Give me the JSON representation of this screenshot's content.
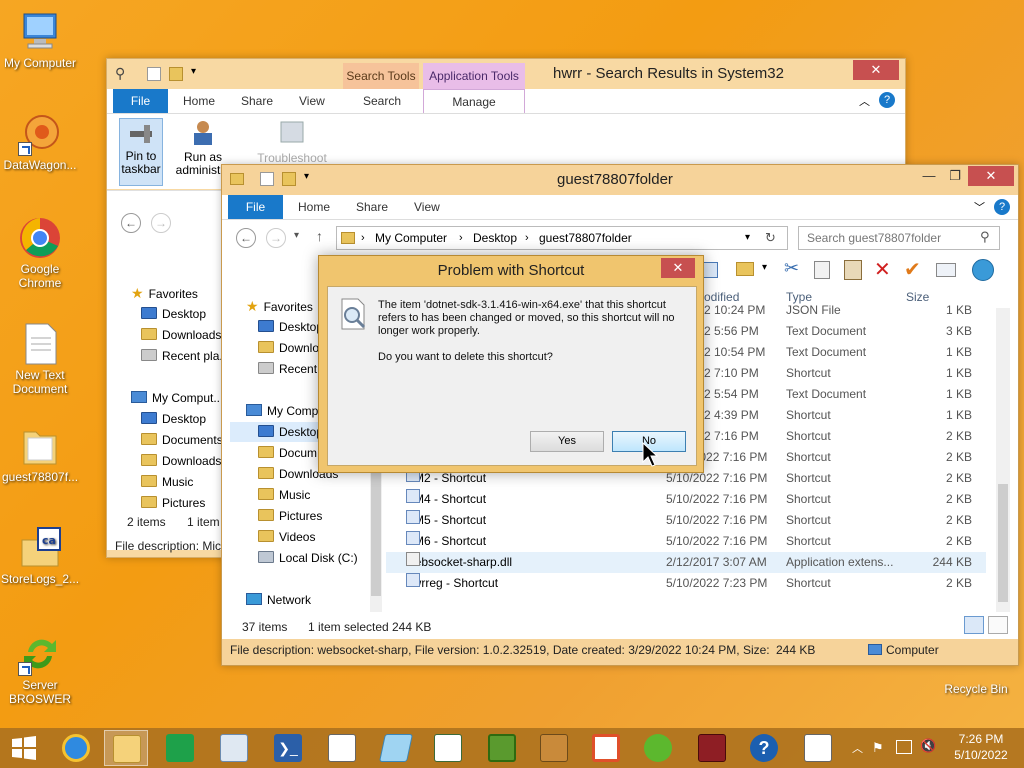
{
  "desktop": {
    "icons": [
      {
        "label": "My Computer"
      },
      {
        "label": "DataWagon..."
      },
      {
        "label": "Google Chrome"
      },
      {
        "label": "New Text Document"
      },
      {
        "label": "guest78807f..."
      },
      {
        "label": "StoreLogs_2..."
      },
      {
        "label": "Server BROSWER"
      },
      {
        "label": "Recycle Bin"
      }
    ]
  },
  "back_window": {
    "title": "hwrr - Search Results in System32",
    "context_tabs": [
      "Search Tools",
      "Application Tools"
    ],
    "tabs": [
      "File",
      "Home",
      "Share",
      "View",
      "Search",
      "Manage"
    ],
    "ribbon_buttons": [
      "Pin to taskbar",
      "Run as administ...",
      "Troubleshoot"
    ],
    "nav": {
      "favorites": "Favorites",
      "items": [
        "Desktop",
        "Downloads",
        "Recent pla..."
      ],
      "my_computer": "My Comput...",
      "mc_items": [
        "Desktop",
        "Documents",
        "Downloads",
        "Music",
        "Pictures"
      ]
    },
    "status": {
      "items": "2 items",
      "selected": "1 item"
    },
    "file_description": "File description: Mic"
  },
  "front_window": {
    "title": "guest78807folder",
    "tabs": [
      "File",
      "Home",
      "Share",
      "View"
    ],
    "address": {
      "crumbs": [
        "My Computer",
        "Desktop",
        "guest78807folder"
      ]
    },
    "search_placeholder": "Search guest78807folder",
    "nav": {
      "favorites": "Favorites",
      "fav_items": [
        "Desktop",
        "Downlo...",
        "Recent"
      ],
      "my_computer": "My Comp...",
      "mc_items": [
        "Desktop",
        "Docum...",
        "Downloads",
        "Music",
        "Pictures",
        "Videos",
        "Local Disk (C:)"
      ],
      "network": "Network"
    },
    "columns": {
      "modified": "odified",
      "type": "Type",
      "size": "Size"
    },
    "files": [
      {
        "name": "",
        "date": "2 10:24 PM",
        "type": "JSON File",
        "size": "1 KB"
      },
      {
        "name": "",
        "date": "2 5:56 PM",
        "type": "Text Document",
        "size": "3 KB"
      },
      {
        "name": "",
        "date": "2 10:54 PM",
        "type": "Text Document",
        "size": "1 KB"
      },
      {
        "name": "",
        "date": "2 7:10 PM",
        "type": "Shortcut",
        "size": "1 KB"
      },
      {
        "name": "",
        "date": "2 5:54 PM",
        "type": "Text Document",
        "size": "1 KB"
      },
      {
        "name": "",
        "date": "2 4:39 PM",
        "type": "Shortcut",
        "size": "1 KB"
      },
      {
        "name": "",
        "date": "2 7:16 PM",
        "type": "Shortcut",
        "size": "2 KB"
      },
      {
        "name": "VM1 - Shortcut",
        "date": "5/10/2022 7:16 PM",
        "type": "Shortcut",
        "size": "2 KB"
      },
      {
        "name": "VM2 - Shortcut",
        "date": "5/10/2022 7:16 PM",
        "type": "Shortcut",
        "size": "2 KB"
      },
      {
        "name": "VM4 - Shortcut",
        "date": "5/10/2022 7:16 PM",
        "type": "Shortcut",
        "size": "2 KB"
      },
      {
        "name": "VM5 - Shortcut",
        "date": "5/10/2022 7:16 PM",
        "type": "Shortcut",
        "size": "2 KB"
      },
      {
        "name": "VM6 - Shortcut",
        "date": "5/10/2022 7:16 PM",
        "type": "Shortcut",
        "size": "2 KB"
      },
      {
        "name": "websocket-sharp.dll",
        "date": "2/12/2017 3:07 AM",
        "type": "Application extens...",
        "size": "244 KB"
      },
      {
        "name": "hwrreg - Shortcut",
        "date": "5/10/2022 7:23 PM",
        "type": "Shortcut",
        "size": "2 KB"
      }
    ],
    "status": {
      "items": "37 items",
      "selected": "1 item selected",
      "size": "244 KB"
    },
    "details": {
      "description": "File description: websocket-sharp, File version: 1.0.2.32519, Date created: 3/29/2022 10:24 PM, Size: 244 K",
      "size": "244 KB",
      "location": "Computer"
    }
  },
  "dialog": {
    "title": "Problem with Shortcut",
    "message": "The item 'dotnet-sdk-3.1.416-win-x64.exe' that this shortcut refers to has been changed or moved, so this shortcut will no longer work properly.",
    "question": "Do you want to delete this shortcut?",
    "yes": "Yes",
    "no": "No"
  },
  "taskbar": {
    "time": "7:26 PM",
    "date": "5/10/2022"
  },
  "colors": {
    "file_tab": "#1979ca",
    "close_button": "#c75050",
    "desktop": "#f39c12"
  }
}
